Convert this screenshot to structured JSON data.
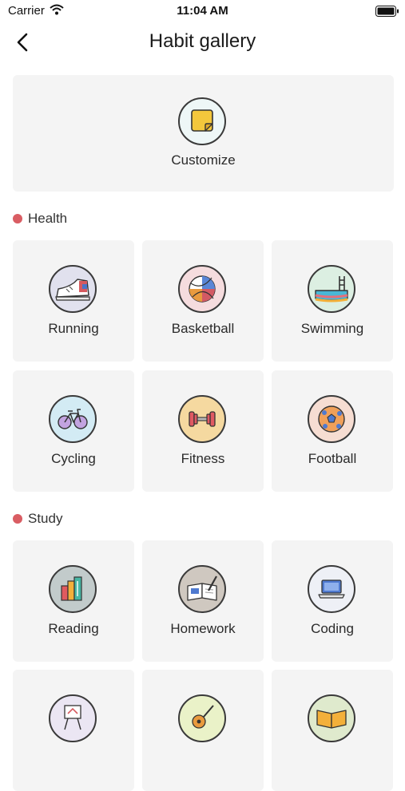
{
  "status_bar": {
    "carrier": "Carrier",
    "time": "11:04 AM"
  },
  "header": {
    "title": "Habit gallery"
  },
  "customize": {
    "label": "Customize",
    "icon": "sticky-note-icon",
    "circle_color": "#eef7f7"
  },
  "sections": [
    {
      "name": "Health",
      "dot_color": "#d95d63",
      "items": [
        {
          "label": "Running",
          "icon": "sneaker-icon",
          "circle_color": "#e1e1ee"
        },
        {
          "label": "Basketball",
          "icon": "basketball-icon",
          "circle_color": "#f5dcde"
        },
        {
          "label": "Swimming",
          "icon": "swim-pool-icon",
          "circle_color": "#dcefe2"
        },
        {
          "label": "Cycling",
          "icon": "bicycle-icon",
          "circle_color": "#d3ebf4"
        },
        {
          "label": "Fitness",
          "icon": "dumbbell-icon",
          "circle_color": "#f5d9a0"
        },
        {
          "label": "Football",
          "icon": "soccer-ball-icon",
          "circle_color": "#f6ddd2"
        }
      ]
    },
    {
      "name": "Study",
      "dot_color": "#d95d63",
      "items": [
        {
          "label": "Reading",
          "icon": "books-icon",
          "circle_color": "#c2cbcb"
        },
        {
          "label": "Homework",
          "icon": "notebook-pen-icon",
          "circle_color": "#cfc8c0"
        },
        {
          "label": "Coding",
          "icon": "laptop-icon",
          "circle_color": "#eef0f6"
        },
        {
          "label": "",
          "icon": "easel-icon",
          "circle_color": "#ebe6f3"
        },
        {
          "label": "",
          "icon": "guitar-icon",
          "circle_color": "#eaf2c8"
        },
        {
          "label": "",
          "icon": "open-book-icon",
          "circle_color": "#dfeacd"
        }
      ]
    }
  ]
}
